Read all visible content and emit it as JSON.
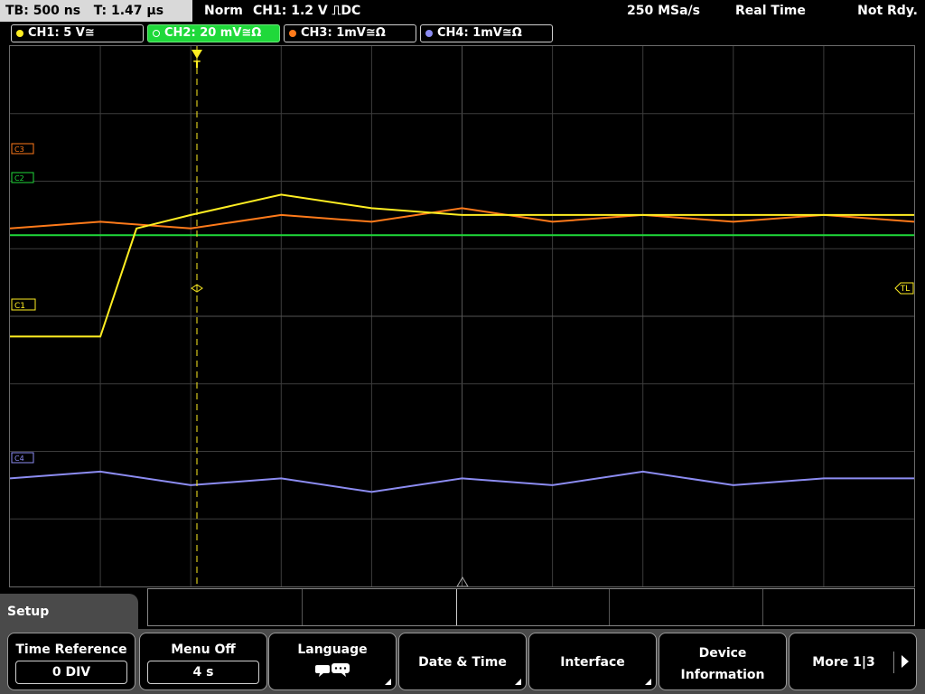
{
  "topbar": {
    "timebase": "TB: 500 ns",
    "trigger_time": "T: 1.47 µs",
    "mode": "Norm",
    "trigger_info": "CH1: 1.2 V ⎍DC",
    "sample_rate": "250 MSa/s",
    "acq_mode": "Real Time",
    "status": "Not Rdy."
  },
  "channels": [
    {
      "id": "ch1",
      "label": "CH1: 5 V≅",
      "color": "#ffee22",
      "active": false
    },
    {
      "id": "ch2",
      "label": "CH2: 20 mV≅Ω",
      "color": "#1fd93a",
      "active": true
    },
    {
      "id": "ch3",
      "label": "CH3: 1mV≅Ω",
      "color": "#ff7a1a",
      "active": false
    },
    {
      "id": "ch4",
      "label": "CH4: 1mV≅Ω",
      "color": "#8c8cf2",
      "active": false
    }
  ],
  "screen": {
    "trigger_marker": "T",
    "trigger_level_marker": "TL",
    "markers": {
      "c1": "C1",
      "c2": "C2",
      "c3": "C3",
      "c4": "C4"
    },
    "colors": {
      "grid": "#3c3c3c",
      "trigger_line": "#ffee22"
    }
  },
  "menu": {
    "title": "Setup",
    "softkeys": {
      "time_reference": {
        "label": "Time Reference",
        "value": "0 DIV"
      },
      "menu_off": {
        "label": "Menu Off",
        "value": "4 s"
      },
      "language": {
        "label": "Language",
        "icon": "speech-bubble-icon"
      },
      "date_time": {
        "label": "Date & Time"
      },
      "interface": {
        "label": "Interface"
      },
      "device_information": {
        "label_line1": "Device",
        "label_line2": "Information"
      },
      "more": {
        "label": "More 1|3"
      }
    }
  },
  "chart_data": {
    "type": "line",
    "x_divisions": 10,
    "y_divisions": 8,
    "series": [
      {
        "name": "CH3",
        "color": "#ff7a1a",
        "x": [
          0,
          1,
          2,
          3,
          4,
          5,
          6,
          7,
          8,
          9,
          10
        ],
        "y": [
          1.3,
          1.4,
          1.3,
          1.5,
          1.4,
          1.6,
          1.4,
          1.5,
          1.4,
          1.5,
          1.4
        ]
      },
      {
        "name": "CH2",
        "color": "#1fd93a",
        "x": [
          0,
          1,
          2,
          3,
          4,
          5,
          6,
          7,
          8,
          9,
          10
        ],
        "y": [
          1.2,
          1.2,
          1.2,
          1.2,
          1.2,
          1.2,
          1.2,
          1.2,
          1.2,
          1.2,
          1.2
        ]
      },
      {
        "name": "CH1",
        "color": "#ffee22",
        "x": [
          0,
          1,
          1.4,
          2,
          3,
          4,
          5,
          6,
          7,
          8,
          10
        ],
        "y": [
          -0.3,
          -0.3,
          1.3,
          1.5,
          1.8,
          1.6,
          1.5,
          1.5,
          1.5,
          1.5,
          1.5
        ]
      },
      {
        "name": "CH4",
        "color": "#8c8cf2",
        "x": [
          0,
          1,
          2,
          3,
          4,
          5,
          6,
          7,
          8,
          9,
          10
        ],
        "y": [
          -2.4,
          -2.3,
          -2.5,
          -2.4,
          -2.6,
          -2.4,
          -2.5,
          -2.3,
          -2.5,
          -2.4,
          -2.4
        ]
      }
    ]
  }
}
